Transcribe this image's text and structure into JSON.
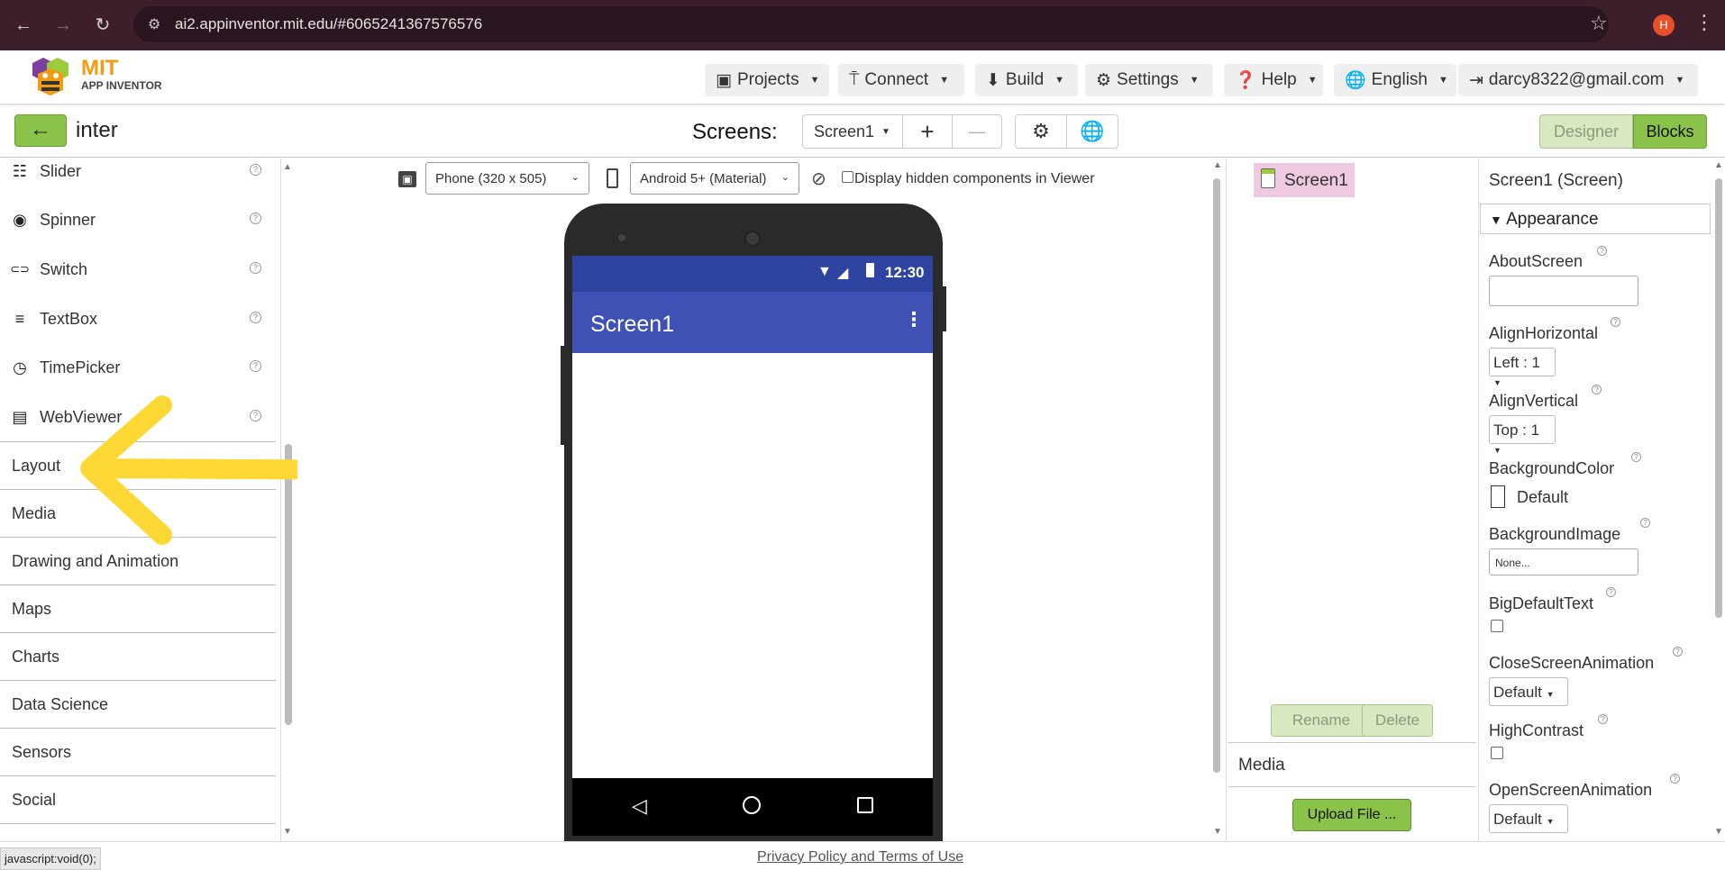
{
  "browser": {
    "url": "ai2.appinventor.mit.edu/#6065241367576576",
    "profile_initial": "H"
  },
  "header": {
    "logo_title": "MIT",
    "logo_subtitle": "APP INVENTOR",
    "menus": [
      {
        "label": "Projects",
        "icon": "archive-icon"
      },
      {
        "label": "Connect",
        "icon": "antenna-icon"
      },
      {
        "label": "Build",
        "icon": "download-icon"
      },
      {
        "label": "Settings",
        "icon": "gear-icon"
      },
      {
        "label": "Help",
        "icon": "help-icon"
      },
      {
        "label": "English",
        "icon": "globe-icon"
      },
      {
        "label": "darcy8322@gmail.com",
        "icon": "logout-icon"
      }
    ]
  },
  "project": {
    "name": "inter",
    "screens_label": "Screens:",
    "current_screen": "Screen1",
    "add_symbol": "+",
    "remove_symbol": "—",
    "designer_label": "Designer",
    "blocks_label": "Blocks"
  },
  "palette": {
    "items": [
      {
        "label": "Slider",
        "icon": "slider-icon",
        "glyph": "☷"
      },
      {
        "label": "Spinner",
        "icon": "spinner-icon",
        "glyph": "◉"
      },
      {
        "label": "Switch",
        "icon": "switch-icon",
        "glyph": "⊂⊃"
      },
      {
        "label": "TextBox",
        "icon": "textbox-icon",
        "glyph": "≡"
      },
      {
        "label": "TimePicker",
        "icon": "clock-icon",
        "glyph": "◷"
      },
      {
        "label": "WebViewer",
        "icon": "webviewer-icon",
        "glyph": "▤"
      }
    ],
    "categories": [
      "Layout",
      "Media",
      "Drawing and Animation",
      "Maps",
      "Charts",
      "Data Science",
      "Sensors",
      "Social"
    ]
  },
  "viewer": {
    "phone_size": "Phone (320 x 505)",
    "theme": "Android 5+ (Material)",
    "hidden_components_label": "Display hidden components in Viewer",
    "status_time": "12:30",
    "app_title": "Screen1"
  },
  "components": {
    "root": "Screen1",
    "rename_label": "Rename",
    "delete_label": "Delete",
    "media_label": "Media",
    "upload_label": "Upload File ..."
  },
  "properties": {
    "title": "Screen1 (Screen)",
    "section": "Appearance",
    "about_screen": "AboutScreen",
    "align_horizontal": "AlignHorizontal",
    "align_horizontal_value": "Left : 1",
    "align_vertical": "AlignVertical",
    "align_vertical_value": "Top : 1",
    "background_color": "BackgroundColor",
    "background_color_value": "Default",
    "background_image": "BackgroundImage",
    "background_image_value": "None...",
    "big_default_text": "BigDefaultText",
    "close_screen_animation": "CloseScreenAnimation",
    "close_screen_animation_value": "Default",
    "high_contrast": "HighContrast",
    "open_screen_animation": "OpenScreenAnimation",
    "open_screen_animation_value": "Default"
  },
  "footer": {
    "privacy_link": "Privacy Policy and Terms of Use",
    "status_text": "javascript:void(0);"
  },
  "colors": {
    "accent_green": "#8bc34a",
    "app_bar": "#3f51b5",
    "status_bar": "#2e44a0",
    "selected_node": "#efc9e0",
    "annotation_arrow": "#fdd835"
  }
}
